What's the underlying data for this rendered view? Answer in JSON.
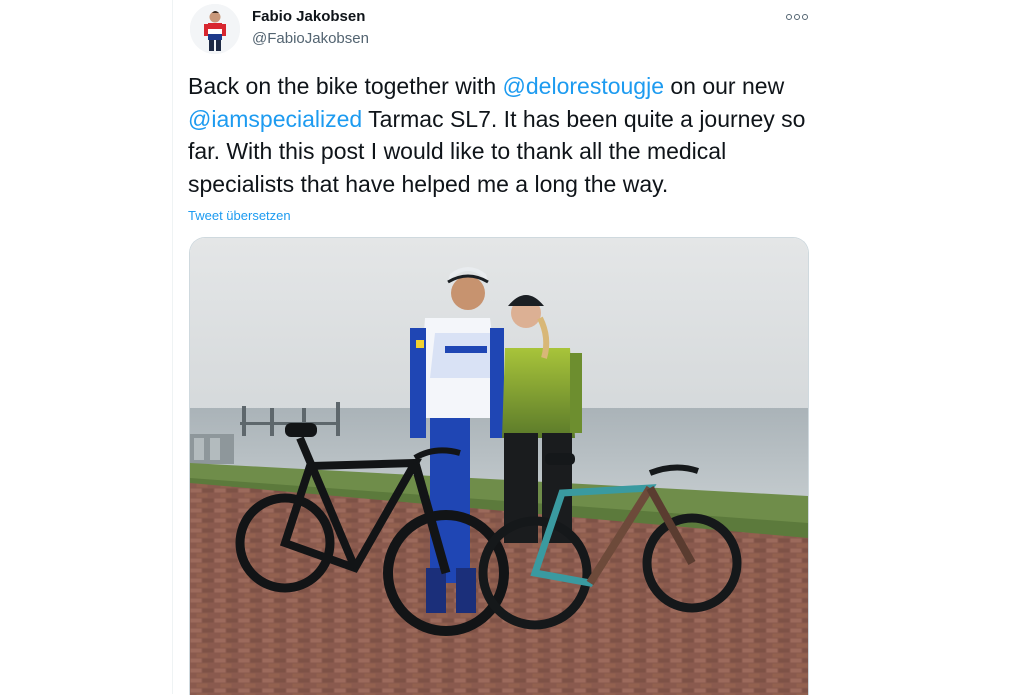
{
  "tweet": {
    "author_name": "Fabio Jakobsen",
    "author_handle": "@FabioJakobsen",
    "text_segments": [
      {
        "text": "Back on the bike together with ",
        "type": "text"
      },
      {
        "text": "@delorestougje",
        "type": "mention"
      },
      {
        "text": " on our new ",
        "type": "text"
      },
      {
        "text": "@iamspecialized",
        "type": "mention"
      },
      {
        "text": " Tarmac SL7. It has been quite a journey so far. With this post I would like to thank all the medical specialists that have helped me a long the way.",
        "type": "text"
      }
    ],
    "translate_label": "Tweet übersetzen"
  },
  "icons": {
    "more": "more-horizontal-icon"
  },
  "colors": {
    "link": "#1d9bf0",
    "text": "#0f1419",
    "secondary": "#536471",
    "border": "#cfd9de"
  }
}
